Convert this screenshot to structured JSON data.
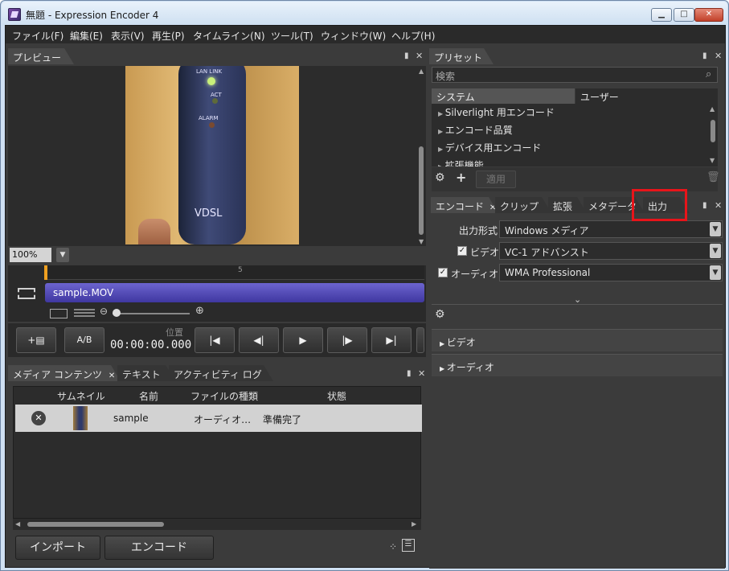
{
  "window": {
    "title": "無題 - Expression Encoder 4",
    "minimize": "▁",
    "maximize": "□",
    "close": "✕"
  },
  "menu": [
    "ファイル(F)",
    "編集(E)",
    "表示(V)",
    "再生(P)",
    "タイムライン(N)",
    "ツール(T)",
    "ウィンドウ(W)",
    "ヘルプ(H)"
  ],
  "preview": {
    "tab": "プレビュー",
    "zoom": "100%",
    "video_text": {
      "lan": "LAN LINK",
      "act": "ACT",
      "alarm": "ALARM",
      "brand": "VDSL"
    }
  },
  "timeline": {
    "ruler_mark": "5",
    "clip_name": "sample.MOV"
  },
  "transport": {
    "ab_label": "A/B",
    "position_label": "位置",
    "timecode": "00:00:00.000"
  },
  "media": {
    "tabs": [
      "メディア コンテンツ",
      "テキスト",
      "アクティビティ ログ"
    ],
    "columns": [
      "サムネイル",
      "名前",
      "ファイルの種類",
      "状態"
    ],
    "rows": [
      {
        "name": "sample",
        "type": "オーディオ…",
        "status": "準備完了"
      }
    ],
    "import_button": "インポート",
    "encode_button": "エンコード"
  },
  "presets": {
    "tab": "プリセット",
    "search_placeholder": "検索",
    "subtabs": [
      "システム",
      "ユーザー"
    ],
    "items": [
      "Silverlight 用エンコード",
      "エンコード品質",
      "デバイス用エンコード",
      "拡張機能"
    ],
    "apply_button": "適用"
  },
  "encode": {
    "tabs": [
      "エンコード",
      "クリップ",
      "拡張",
      "メタデータ",
      "出力"
    ],
    "output_format_label": "出力形式",
    "output_format_value": "Windows メディア",
    "video_label": "ビデオ",
    "video_value": "VC-1 アドバンスト",
    "audio_label": "オーディオ",
    "audio_value": "WMA Professional",
    "sections": [
      "ビデオ",
      "オーディオ"
    ]
  },
  "colors": {
    "highlight": "#e8141a",
    "clip": "#5a52c0"
  }
}
